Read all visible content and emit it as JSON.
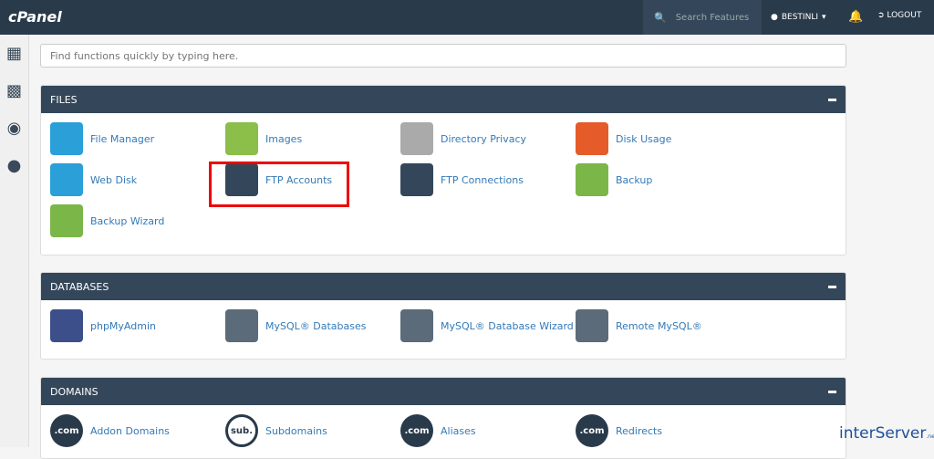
{
  "header": {
    "logo": "cPanel",
    "search_placeholder": "Search Features",
    "user": "BESTINLI",
    "logout": "LOGOUT"
  },
  "sidebar": [
    {
      "icon": "grid-icon"
    },
    {
      "icon": "stats-icon"
    },
    {
      "icon": "palette-icon"
    },
    {
      "icon": "users-icon"
    }
  ],
  "find_placeholder": "Find functions quickly by typing here.",
  "sections": [
    {
      "title": "FILES",
      "items": [
        {
          "label": "File Manager",
          "color": "#2a9fd8"
        },
        {
          "label": "Images",
          "color": "#8bbf4a"
        },
        {
          "label": "Directory Privacy",
          "color": "#aaaaaa"
        },
        {
          "label": "Disk Usage",
          "color": "#e55b2a"
        },
        {
          "label": "Web Disk",
          "color": "#2a9fd8"
        },
        {
          "label": "FTP Accounts",
          "color": "#34475a"
        },
        {
          "label": "FTP Connections",
          "color": "#34475a"
        },
        {
          "label": "Backup",
          "color": "#7ab648"
        },
        {
          "label": "Backup Wizard",
          "color": "#7ab648"
        }
      ]
    },
    {
      "title": "DATABASES",
      "items": [
        {
          "label": "phpMyAdmin",
          "color": "#3d4f8a"
        },
        {
          "label": "MySQL® Databases",
          "color": "#5b6b7a"
        },
        {
          "label": "MySQL® Database Wizard",
          "color": "#5b6b7a"
        },
        {
          "label": "Remote MySQL®",
          "color": "#5b6b7a"
        }
      ]
    },
    {
      "title": "DOMAINS",
      "items": [
        {
          "label": "Addon Domains",
          "color": "#293a4a",
          "glyph": ".com"
        },
        {
          "label": "Subdomains",
          "color": "#ffffff",
          "glyph": "sub."
        },
        {
          "label": "Aliases",
          "color": "#293a4a",
          "glyph": ".com"
        },
        {
          "label": "Redirects",
          "color": "#293a4a",
          "glyph": ".com"
        }
      ]
    }
  ],
  "watermark": "interServer.net"
}
